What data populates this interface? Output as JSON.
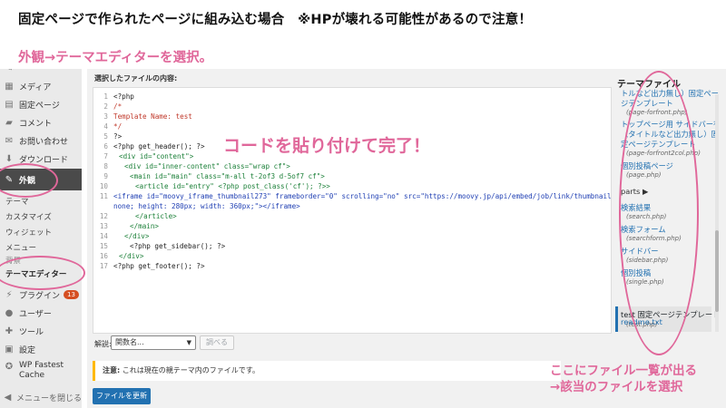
{
  "slide": {
    "title": "固定ページで作られたページに組み込む場合　※HPが壊れる可能性があるので注意！",
    "instruction": "外観→テーマエディターを選択。",
    "paste_note": "コードを貼り付けて完了！",
    "list_note_line1": "ここにファイル一覧が出る",
    "list_note_line2": "→該当のファイルを選択"
  },
  "sidebar": {
    "items": {
      "media": "メディア",
      "pages": "固定ページ",
      "comments": "コメント",
      "contact": "お問い合わせ",
      "download": "ダウンロード",
      "appearance": "外観",
      "plugins": "プラグイン",
      "plugins_badge": "13",
      "users": "ユーザー",
      "tools": "ツール",
      "settings": "設定",
      "wpfc": "WP Fastest Cache",
      "collapse": "メニューを閉じる"
    },
    "submenu": {
      "themes": "テーマ",
      "customize": "カスタマイズ",
      "widgets": "ウィジェット",
      "menus": "メニュー",
      "background": "背景",
      "theme_editor": "テーマエディター"
    }
  },
  "editor": {
    "file_label": "選択したファイルの内容:",
    "lines": {
      "n1": "1",
      "n2": "2",
      "n3": "3",
      "n4": "4",
      "n5": "5",
      "n6": "6",
      "n7": "7",
      "n8": "8",
      "n9": "9",
      "n10": "10",
      "n11": "11",
      "n12": "12",
      "n13": "13",
      "n14": "14",
      "n15": "15",
      "n16": "16",
      "n17": "17",
      "l1": "<?php",
      "l2": "/*",
      "l3": "Template Name: test",
      "l4": "*/",
      "l5": "?>",
      "l6": "<?php get_header(); ?>",
      "l7": "<div id=\"content\">",
      "l8": "<div id=\"inner-content\" class=\"wrap cf\">",
      "l9": "<main id=\"main\" class=\"m-all t-2of3 d-5of7 cf\">",
      "l10": "<article id=\"entry\" <?php post_class('cf'); ?>>",
      "l11a": "<iframe id=\"moovy_iframe_thumbnail273\" frameborder=\"0\" scrolling=\"no\" src=\"https://moovy.jp/api/embed/job/link/thumbnail/273\" style=\"border:",
      "l11b": "none; height: 280px; width: 360px;\"></iframe>",
      "l12": "</article>",
      "l13": "</main>",
      "l14": "</div>",
      "l15": "<?php get_sidebar(); ?>",
      "l16": "</div>",
      "l17": "<?php get_footer(); ?>"
    },
    "doc_label": "解説:",
    "doc_select": "関数名...",
    "lookup_button": "調べる",
    "notice_strong": "注意:",
    "notice_text": " これは現在の親テーマ内のファイルです。",
    "update_button": "ファイルを更新"
  },
  "theme_files": {
    "title": "テーマファイル",
    "entries": {
      "e1_name_a": "トルなど出力無し）固定ペー",
      "e1_name_b": "ジテンプレート",
      "e1_file": "(page-forfront.php)",
      "e2_name_a": "トップページ用 サイドバー有",
      "e2_name_b": "（タイトルなど出力無し）固",
      "e2_name_c": "定ページテンプレート",
      "e2_file": "(page-forfront2col.php)",
      "e3_name": "個別投稿ページ",
      "e3_file": "(page.php)",
      "parts": "parts ▶",
      "e4_name": "検索結果",
      "e4_file": "(search.php)",
      "e5_name": "検索フォーム",
      "e5_file": "(searchform.php)",
      "e6_name": "サイドバー",
      "e6_file": "(sidebar.php)",
      "e7_name": "個別投稿",
      "e7_file": "(single.php)",
      "e8_name": "test 固定ページテンプレート",
      "e8_file": "(test.php)",
      "readme": "readme.txt"
    }
  },
  "colors": {
    "accent_pink": "#e0679a",
    "wp_blue": "#2271b1",
    "wp_dark": "#4a4a4a",
    "notice_yellow": "#ffb900"
  }
}
